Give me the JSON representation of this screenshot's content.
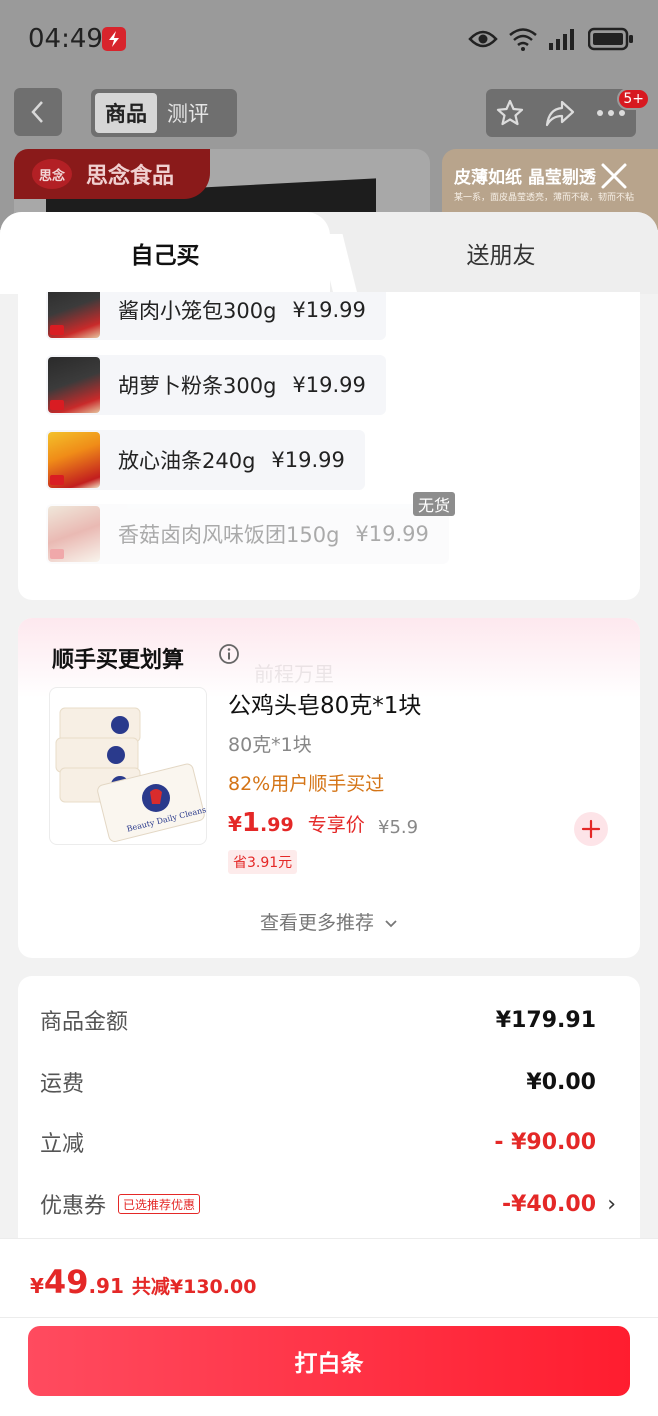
{
  "status_bar": {
    "time": "04:49",
    "icons": [
      "app-notification-icon",
      "eye-icon",
      "wifi-icon",
      "signal-icon",
      "battery-icon"
    ]
  },
  "background_page": {
    "tabs": [
      "商品",
      "测评"
    ],
    "active_tab": "商品",
    "badge": "5+",
    "brand_logo": "思念",
    "brand_name": "思念食品",
    "banner_title": "皮薄如纸 晶莹剔透",
    "banner_subtitle": "某一系，面皮晶莹透亮，薄而不破，韧而不粘"
  },
  "sheet": {
    "tabs": [
      "自己买",
      "送朋友"
    ],
    "active_tab": "自己买"
  },
  "items": [
    {
      "name": "酱肉小笼包300g",
      "price": "¥19.99",
      "available": true
    },
    {
      "name": "胡萝卜粉条300g",
      "price": "¥19.99",
      "available": true
    },
    {
      "name": "放心油条240g",
      "price": "¥19.99",
      "available": true
    },
    {
      "name": "香菇卤肉风味饭团150g",
      "price": "¥19.99",
      "available": false
    }
  ],
  "out_of_stock_label": "无货",
  "recommend": {
    "title": "顺手买更划算",
    "watermark": "前程万里",
    "product": {
      "name": "公鸡头皂80克*1块",
      "spec": "80克*1块",
      "social_proof": "82%用户顺手买过",
      "price_symbol": "¥",
      "price_int": "1",
      "price_dec": ".99",
      "price_label": "专享价",
      "original_price": "¥5.9",
      "save": "省3.91元"
    },
    "more": "查看更多推荐"
  },
  "summary": {
    "rows": [
      {
        "label": "商品金额",
        "value": "¥179.91"
      },
      {
        "label": "运费",
        "value": "¥0.00"
      },
      {
        "label": "立减",
        "value": "- ¥90.00"
      },
      {
        "label": "优惠券",
        "value": "-¥40.00",
        "tag": "已选推荐优惠"
      }
    ]
  },
  "bottom": {
    "total_symbol": "¥",
    "total_int": "49",
    "total_dec": ".91",
    "total_reduce": "共减¥130.00",
    "pay_label": "打白条"
  },
  "colors": {
    "accent": "#e42827",
    "pay_gradient_start": "#ff4b5f",
    "pay_gradient_end": "#ff1d2f",
    "orange_text": "#d47416"
  }
}
